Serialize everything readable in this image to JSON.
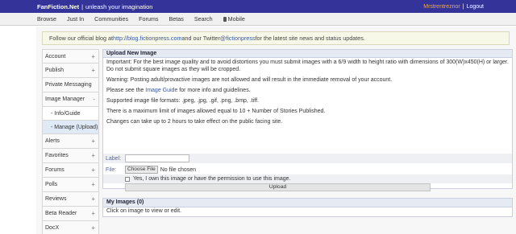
{
  "topbar": {
    "brand": "FanFiction.Net",
    "separator": "|",
    "tagline": "unleash your imagination",
    "username": "Mrstrentreznor",
    "bar": "|",
    "logout": "Logout"
  },
  "nav": {
    "items": [
      "Browse",
      "Just In",
      "Communities",
      "Forums",
      "Betas",
      "Search"
    ],
    "mobile": "Mobile"
  },
  "notice": {
    "before_blog": "Follow our official blog at ",
    "blog_url": "http://blog.fictionpress.com",
    "middle": " and our Twitter ",
    "twitter": "@fictionpress",
    "after": " for the latest site news and status updates."
  },
  "sidebar": {
    "items": [
      {
        "label": "Account",
        "sign": "+"
      },
      {
        "label": "Publish",
        "sign": "+"
      },
      {
        "label": "Private Messaging",
        "sign": ""
      },
      {
        "label": "Image Manager",
        "sign": "-"
      },
      {
        "label": "- Info/Guide",
        "sign": ""
      },
      {
        "label": "- Manage (Upload)",
        "sign": ""
      },
      {
        "label": "Alerts",
        "sign": "+"
      },
      {
        "label": "Favorites",
        "sign": "+"
      },
      {
        "label": "Forums",
        "sign": "+"
      },
      {
        "label": "Polls",
        "sign": "+"
      },
      {
        "label": "Reviews",
        "sign": "+"
      },
      {
        "label": "Beta Reader",
        "sign": "+"
      },
      {
        "label": "DocX",
        "sign": "+"
      }
    ]
  },
  "upload": {
    "title": "Upload New Image",
    "important": "Important: For the best image quality and to avoid distortions you must submit images with a 6/9 width to height ratio with dimensions of 300(W)x450(H) or larger. Do not submit square images as they will be cropped.",
    "warning": "Warning: Posting adult/provactive images are not allowed and will result in the immediate removal of your account.",
    "guide_before": "Please see the ",
    "guide_link": "Image Guide",
    "guide_after": " for more info and guidelines.",
    "formats": "Supported image file formats: .jpeg, .jpg, .gif, .png, .bmp, .tiff.",
    "limit": "There is a maximum limit of images allowed equal to 10 + Number of Stories Published.",
    "delay": "Changes can take up to 2 hours to take effect on the public facing site.",
    "label_field": "Label:",
    "label_value": "",
    "file_field": "File:",
    "choose_file": "Choose File",
    "no_file": "No file chosen",
    "permission": "Yes, I own this image or have the permission to use this image.",
    "upload_button": "Upload"
  },
  "myimages": {
    "title": "My Images (0)",
    "hint": "Click on image to view or edit."
  }
}
